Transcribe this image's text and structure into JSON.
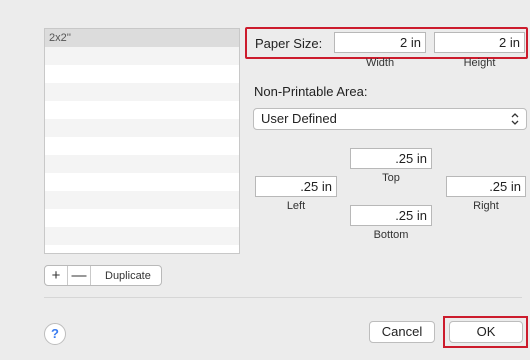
{
  "list": {
    "items": [
      "2x2''",
      "",
      "",
      "",
      "",
      "",
      "",
      "",
      "",
      "",
      "",
      "",
      ""
    ]
  },
  "list_buttons": {
    "add_label": "+",
    "remove_label": "—",
    "duplicate_label": "Duplicate"
  },
  "paper_size": {
    "label": "Paper Size:",
    "width_value": "2 in",
    "height_value": "2 in",
    "width_label": "Width",
    "height_label": "Height"
  },
  "non_printable": {
    "label": "Non-Printable Area:",
    "select_value": "User Defined",
    "top_value": ".25 in",
    "top_label": "Top",
    "left_value": ".25 in",
    "left_label": "Left",
    "right_value": ".25 in",
    "right_label": "Right",
    "bottom_value": ".25 in",
    "bottom_label": "Bottom"
  },
  "footer": {
    "help_label": "?",
    "cancel_label": "Cancel",
    "ok_label": "OK"
  },
  "colors": {
    "highlight": "#cc1b2c",
    "help_accent": "#3a7cf0"
  }
}
